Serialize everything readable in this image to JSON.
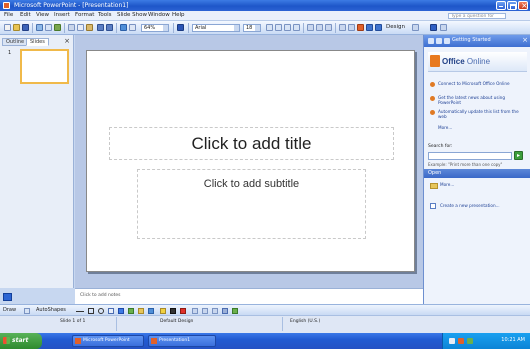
{
  "window": {
    "title": "Microsoft PowerPoint - [Presentation1]"
  },
  "menubar": {
    "items": [
      "File",
      "Edit",
      "View",
      "Insert",
      "Format",
      "Tools",
      "Slide Show",
      "Window",
      "Help"
    ],
    "help_placeholder": "Type a question for help"
  },
  "toolbar": {
    "font": "Arial",
    "size": "18",
    "zoom": "64%",
    "design_label": "Design"
  },
  "outline_pane": {
    "tabs": [
      "Outline",
      "Slides"
    ],
    "slide_number": "1"
  },
  "slide": {
    "title_placeholder": "Click to add title",
    "subtitle_placeholder": "Click to add subtitle"
  },
  "notes": {
    "placeholder": "Click to add notes"
  },
  "task_pane": {
    "title": "Getting Started",
    "logo_text_1": "Office",
    "logo_text_2": "Online",
    "links": [
      "Connect to Microsoft Office Online",
      "Get the latest news about using PowerPoint",
      "Automatically update this list from the web",
      "More..."
    ],
    "search_label": "Search for:",
    "example": "Example: \"Print more than one copy\"",
    "open_header": "Open",
    "more_label": "More...",
    "new_label": "Create a new presentation..."
  },
  "draw_toolbar": {
    "draw_label": "Draw",
    "autoshapes_label": "AutoShapes"
  },
  "statusbar": {
    "slide": "Slide 1 of 1",
    "design": "Default Design",
    "language": "English (U.S.)"
  },
  "taskbar": {
    "start_label": "start",
    "items": [
      "Microsoft PowerPoint",
      "Presentation1"
    ],
    "clock": "10:21 AM"
  }
}
